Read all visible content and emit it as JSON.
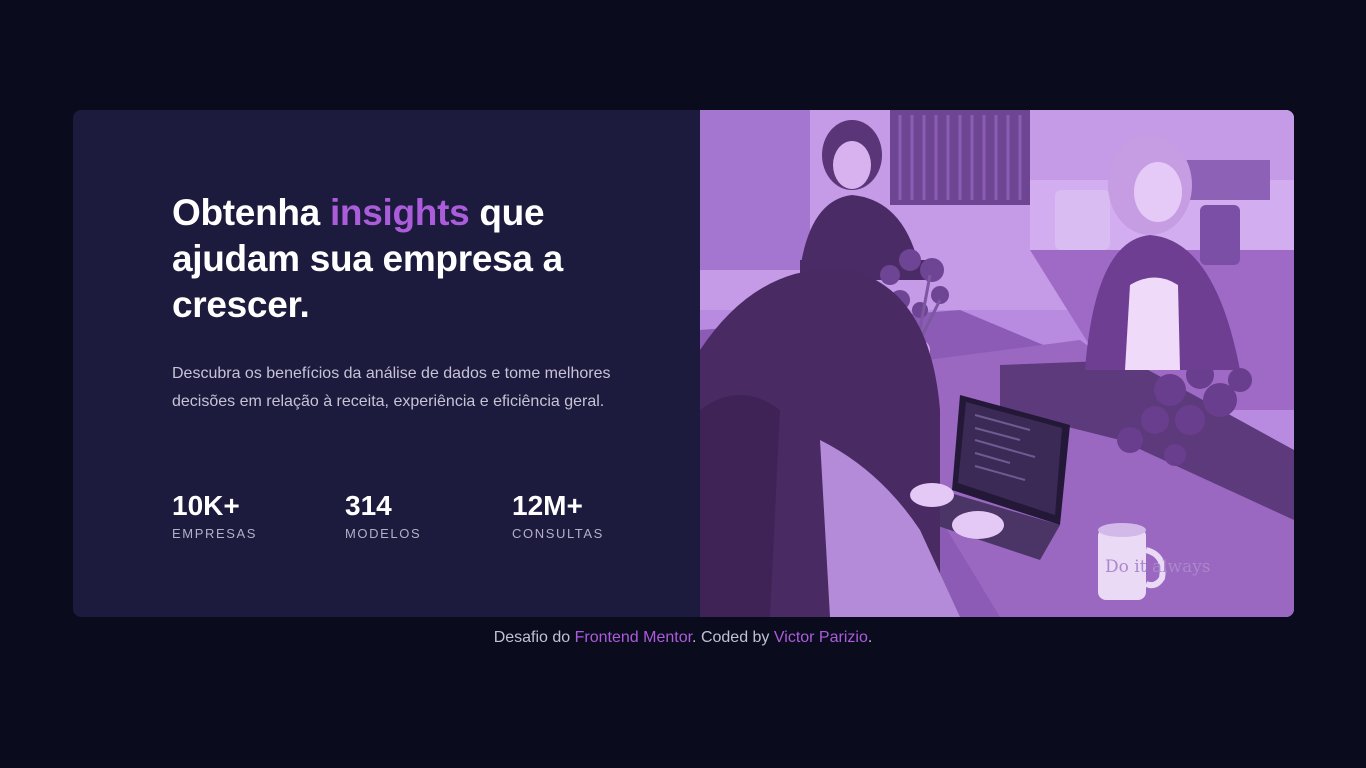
{
  "hero": {
    "title_before": "Obtenha ",
    "title_accent": "insights",
    "title_after": " que ajudam sua empresa a crescer.",
    "description": "Descubra os benefícios da análise de dados e tome melhores decisões em relação à receita, experiência e eficiência geral."
  },
  "stats": [
    {
      "value": "10K+",
      "label": "EMPRESAS"
    },
    {
      "value": "314",
      "label": "MODELOS"
    },
    {
      "value": "12M+",
      "label": "CONSULTAS"
    }
  ],
  "image": {
    "icon": "office-photo",
    "mug_text": "Do it always"
  },
  "footer": {
    "prefix": "Desafio do ",
    "link1": "Frontend Mentor",
    "middle": ". Coded by ",
    "link2": "Victor Parizio",
    "suffix": "."
  },
  "colors": {
    "page_bg": "#0a0c1d",
    "card_bg": "#1c1a3d",
    "accent": "#ab5cdb",
    "image_tint": "#a87ad6"
  }
}
